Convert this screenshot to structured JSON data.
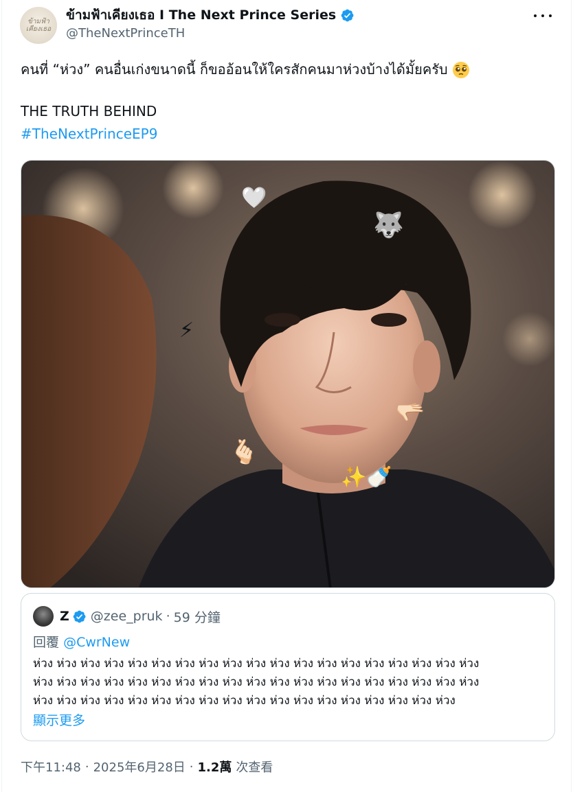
{
  "author": {
    "display_name": "ข้ามฟ้าเคียงเธอ I The Next Prince Series",
    "handle": "@TheNextPrinceTH",
    "avatar_text_line1": "ข้ามฟ้า",
    "avatar_text_line2": "เคียงเธอ"
  },
  "tweet": {
    "line1": "คนที่ “ห่วง” คนอื่นเก่งขนาดนี้ ก็ขออ้อนให้ใครสักคนมาห่วงบ้างได้มั้ยครับ",
    "line1_emoji": "pleading-face",
    "title": "THE TRUTH BEHIND",
    "hashtag": "#TheNextPrinceEP9"
  },
  "media": {
    "stickers": [
      "🤍",
      "🐺",
      "⚡",
      "🫰🏻",
      "🫳🏻",
      "✨🍼"
    ]
  },
  "quote": {
    "name": "Z",
    "handle": "@zee_pruk",
    "time": "59 分鐘",
    "reply_prefix": "回覆",
    "reply_mention": "@CwrNew",
    "body_lines": [
      "ห่วง ห่วง ห่วง ห่วง ห่วง ห่วง ห่วง ห่วง ห่วง ห่วง ห่วง ห่วง ห่วง ห่วง ห่วง ห่วง ห่วง ห่วง ห่วง",
      "ห่วง ห่วง ห่วง ห่วง ห่วง ห่วง ห่วง ห่วง ห่วง ห่วง ห่วง ห่วง ห่วง ห่วง ห่วง ห่วง ห่วง ห่วง ห่วง",
      "ห่วง ห่วง ห่วง ห่วง ห่วง ห่วง ห่วง ห่วง ห่วง ห่วง ห่วง ห่วง ห่วง ห่วง ห่วง ห่วง ห่วง ห่วง"
    ],
    "show_more": "顯示更多"
  },
  "meta": {
    "time": "下午11:48",
    "date": "2025年6月28日",
    "views": "1.2萬",
    "views_label": "次查看"
  },
  "colors": {
    "accent": "#1d9bf0",
    "secondary_text": "#536471",
    "border": "#cfd9de"
  }
}
